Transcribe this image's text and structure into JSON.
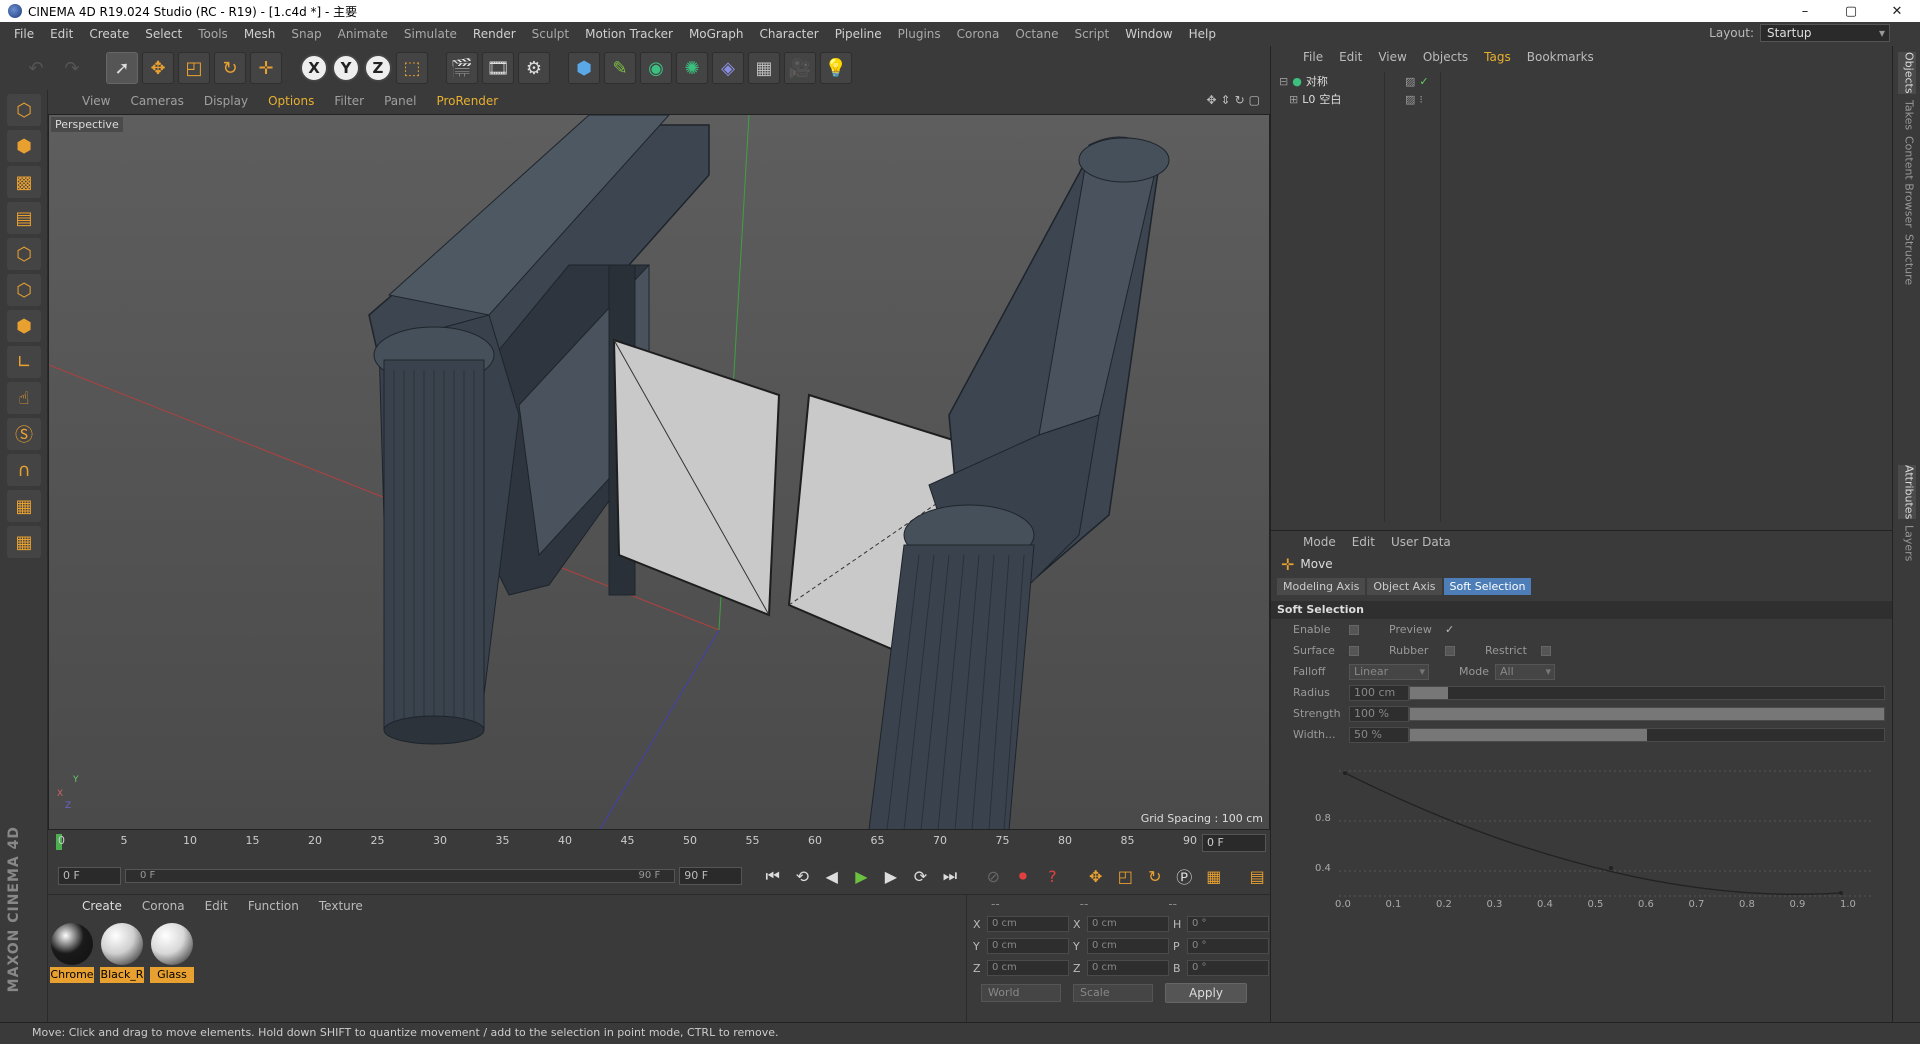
{
  "window": {
    "title": "CINEMA 4D R19.024 Studio (RC - R19) - [1.c4d *] - 主要",
    "controls": [
      "–",
      "▢",
      "✕"
    ]
  },
  "menubar": {
    "items": [
      "File",
      "Edit",
      "Create",
      "Select",
      "Tools",
      "Mesh",
      "Snap",
      "Animate",
      "Simulate",
      "Render",
      "Sculpt",
      "Motion Tracker",
      "MoGraph",
      "Character",
      "Pipeline",
      "Plugins",
      "Corona",
      "Octane",
      "Script",
      "Window",
      "Help"
    ],
    "layout_label": "Layout:",
    "layout_value": "Startup"
  },
  "viewport": {
    "menu": [
      "View",
      "Cameras",
      "Display",
      "Options",
      "Filter",
      "Panel",
      "ProRender"
    ],
    "label": "Perspective",
    "grid_spacing": "Grid Spacing : 100 cm",
    "axis_gizmo": [
      "Y",
      "X",
      "Z"
    ]
  },
  "timeline": {
    "ticks": [
      "0",
      "5",
      "10",
      "15",
      "20",
      "25",
      "30",
      "35",
      "40",
      "45",
      "50",
      "55",
      "60",
      "65",
      "70",
      "75",
      "80",
      "85",
      "90"
    ],
    "current_frame": "0 F"
  },
  "transport": {
    "start_field": "0 F",
    "slider_start": "0 F",
    "slider_end": "90 F",
    "end_field": "90 F"
  },
  "materials": {
    "menu": [
      "Create",
      "Corona",
      "Edit",
      "Function",
      "Texture"
    ],
    "items": [
      {
        "label": "Chrome",
        "color": "#1a1a1a"
      },
      {
        "label": "Black_R",
        "color": "#cfcfcf"
      },
      {
        "label": "Glass",
        "color": "#d8d8d8"
      }
    ]
  },
  "coords": {
    "headers": [
      "--",
      "--",
      "--"
    ],
    "rows": [
      {
        "a": "X",
        "av": "0 cm",
        "b": "X",
        "bv": "0 cm",
        "c": "H",
        "cv": "0 °"
      },
      {
        "a": "Y",
        "av": "0 cm",
        "b": "Y",
        "bv": "0 cm",
        "c": "P",
        "cv": "0 °"
      },
      {
        "a": "Z",
        "av": "0 cm",
        "b": "Z",
        "bv": "0 cm",
        "c": "B",
        "cv": "0 °"
      }
    ],
    "world": "World",
    "scale": "Scale",
    "apply": "Apply"
  },
  "status": "Move: Click and drag to move elements. Hold down SHIFT to quantize movement / add to the selection in point mode, CTRL to remove.",
  "objects": {
    "menu": [
      "File",
      "Edit",
      "View",
      "Objects",
      "Tags",
      "Bookmarks"
    ],
    "rows": [
      "对称",
      "空白"
    ]
  },
  "right_tabs": [
    "Objects",
    "Takes",
    "Content Browser",
    "Structure",
    "Attributes",
    "Layers"
  ],
  "attributes": {
    "menu": [
      "Mode",
      "Edit",
      "User Data"
    ],
    "tool": "Move",
    "tabs": [
      "Modeling Axis",
      "Object Axis",
      "Soft Selection"
    ],
    "section": "Soft Selection",
    "enable": "Enable",
    "preview": "Preview",
    "preview_check": "✓",
    "surface": "Surface",
    "rubber": "Rubber",
    "restrict": "Restrict",
    "falloff": "Falloff",
    "falloff_value": "Linear",
    "mode": "Mode",
    "mode_value": "All",
    "radius": "Radius",
    "radius_value": "100 cm",
    "radius_fill": 0.08,
    "strength": "Strength",
    "strength_value": "100 %",
    "strength_fill": 1.0,
    "width": "Width...",
    "width_value": "50 %",
    "width_fill": 0.5,
    "graph_y": [
      "0.8",
      "0.4"
    ],
    "graph_x": [
      "0.0",
      "0.1",
      "0.2",
      "0.3",
      "0.4",
      "0.5",
      "0.6",
      "0.7",
      "0.8",
      "0.9",
      "1.0"
    ]
  }
}
